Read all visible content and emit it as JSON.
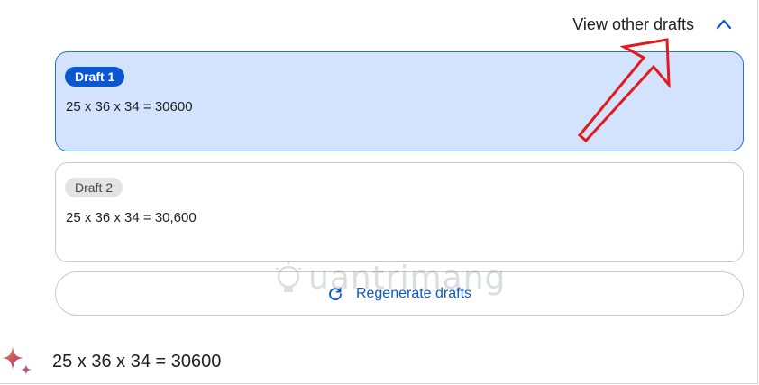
{
  "header": {
    "view_drafts_label": "View other drafts"
  },
  "drafts": [
    {
      "badge": "Draft 1",
      "text": "25 x 36 x 34 = 30600",
      "selected": true
    },
    {
      "badge": "Draft 2",
      "text": "25 x 36 x 34 = 30,600",
      "selected": false
    }
  ],
  "regenerate": {
    "label": "Regenerate drafts",
    "icon": "refresh-icon"
  },
  "response": {
    "icon": "sparkle-icon",
    "text": "25 x 36 x 34 = 30600"
  },
  "watermark": {
    "text": "uantrimang",
    "icon": "lightbulb-icon"
  },
  "colors": {
    "selected_bg": "#d3e3fd",
    "selected_border": "#1a73e8",
    "badge_active": "#0b57d0",
    "badge_inactive": "#e3e3e3",
    "link_blue": "#0b57d0",
    "annotation_red": "#e01b1b"
  }
}
